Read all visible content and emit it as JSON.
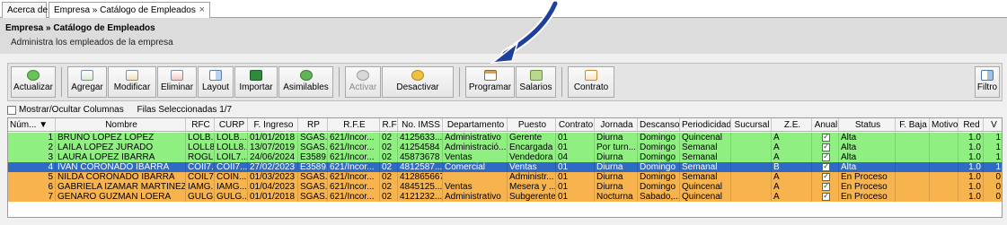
{
  "tabs": [
    {
      "label": "Acerca de"
    },
    {
      "label": "Empresa » Catálogo de Empleados",
      "close": "×"
    }
  ],
  "header": {
    "breadcrumb": "Empresa » Catálogo de Empleados",
    "subtitle": "Administra los empleados de la empresa"
  },
  "toolbar": {
    "actualizar": "Actualizar",
    "agregar": "Agregar",
    "modificar": "Modificar",
    "eliminar": "Eliminar",
    "layout": "Layout",
    "importar": "Importar",
    "asimilables": "Asimilables",
    "activar": "Activar",
    "desactivar": "Desactivar",
    "programar": "Programar",
    "salarios": "Salarios",
    "contrato": "Contrato",
    "filtro": "Filtro"
  },
  "options": {
    "show_hide_columns": "Mostrar/Ocultar Columnas",
    "selected_rows": "Filas Seleccionadas 1/7"
  },
  "columns": {
    "num": "Núm...",
    "nombre": "Nombre",
    "rfc": "RFC",
    "curp": "CURP",
    "ingreso": "F. Ingreso",
    "rp": "RP",
    "rfe": "R.F.E",
    "rf": "R.F",
    "imss": "No. IMSS",
    "depto": "Departamento",
    "puesto": "Puesto",
    "contrato": "Contrato",
    "jornada": "Jornada",
    "descanso": "Descanso",
    "periodicidad": "Periodicidad",
    "sucursal": "Sucursal",
    "ze": "Z.E.",
    "anual": "Anual",
    "status": "Status",
    "baja": "F. Baja",
    "motivo": "Motivo",
    "red": "Red",
    "v": "V"
  },
  "rows": [
    {
      "num": "1",
      "nombre": "BRUNO LOPEZ LOPEZ",
      "rfc": "LOLB...",
      "curp": "LOLB...",
      "ingreso": "01/01/2018",
      "rp": "SGAS...",
      "rfe": "621/Incor...",
      "rf": "02",
      "imss": "4125633...",
      "depto": "Administrativo",
      "puesto": "Gerente",
      "contrato": "01",
      "jornada": "Diurna",
      "descanso": "Domingo",
      "periodicidad": "Quincenal",
      "sucursal": "",
      "ze": "A",
      "status": "Alta",
      "baja": "",
      "motivo": "",
      "red": "1.0",
      "v": "1",
      "color": "green"
    },
    {
      "num": "2",
      "nombre": "LAILA LOPEZ JURADO",
      "rfc": "LOLL8...",
      "curp": "LOLL8...",
      "ingreso": "13/07/2019",
      "rp": "SGAS...",
      "rfe": "621/Incor...",
      "rf": "02",
      "imss": "41254584",
      "depto": "Administració...",
      "puesto": "Encargada",
      "contrato": "01",
      "jornada": "Por turn...",
      "descanso": "Domingo",
      "periodicidad": "Semanal",
      "sucursal": "",
      "ze": "A",
      "status": "Alta",
      "baja": "",
      "motivo": "",
      "red": "1.0",
      "v": "1",
      "color": "green"
    },
    {
      "num": "3",
      "nombre": "LAURA LOPEZ IBARRA",
      "rfc": "ROGL...",
      "curp": "LOIL7...",
      "ingreso": "24/06/2024",
      "rp": "E3589...",
      "rfe": "621/Incor...",
      "rf": "02",
      "imss": "45873678",
      "depto": "Ventas",
      "puesto": "Vendedora",
      "contrato": "04",
      "jornada": "Diurna",
      "descanso": "Domingo",
      "periodicidad": "Semanal",
      "sucursal": "",
      "ze": "A",
      "status": "Alta",
      "baja": "",
      "motivo": "",
      "red": "1.0",
      "v": "1",
      "color": "green"
    },
    {
      "num": "4",
      "nombre": "IVAN CORONADO IBARRA",
      "rfc": "COII7...",
      "curp": "COII7...",
      "ingreso": "27/02/2023",
      "rp": "E3589...",
      "rfe": "621/Incor...",
      "rf": "02",
      "imss": "4812587...",
      "depto": "Comercial",
      "puesto": "Ventas",
      "contrato": "01",
      "jornada": "Diurna",
      "descanso": "Domingo",
      "periodicidad": "Semanal",
      "sucursal": "",
      "ze": "B",
      "status": "Alta",
      "baja": "",
      "motivo": "",
      "red": "1.0",
      "v": "1",
      "color": "sel"
    },
    {
      "num": "5",
      "nombre": "NILDA CORONADO IBARRA",
      "rfc": "COIL7...",
      "curp": "COIN...",
      "ingreso": "01/03/2023",
      "rp": "SGAS...",
      "rfe": "621/Incor...",
      "rf": "02",
      "imss": "412865667",
      "depto": "",
      "puesto": "Administr...",
      "contrato": "01",
      "jornada": "Diurna",
      "descanso": "Domingo",
      "periodicidad": "Semanal",
      "sucursal": "",
      "ze": "A",
      "status": "En Proceso",
      "baja": "",
      "motivo": "",
      "red": "1.0",
      "v": "0",
      "color": "orange"
    },
    {
      "num": "6",
      "nombre": "GABRIELA IZAMAR MARTINEZ",
      "rfc": "IAMG...",
      "curp": "IAMG...",
      "ingreso": "01/04/2023",
      "rp": "SGAS...",
      "rfe": "621/Incor...",
      "rf": "02",
      "imss": "4845125...",
      "depto": "Ventas",
      "puesto": "Mesera y ...",
      "contrato": "01",
      "jornada": "Diurna",
      "descanso": "Domingo",
      "periodicidad": "Quincenal",
      "sucursal": "",
      "ze": "A",
      "status": "En Proceso",
      "baja": "",
      "motivo": "",
      "red": "1.0",
      "v": "0",
      "color": "orange"
    },
    {
      "num": "7",
      "nombre": "GENARO GUZMAN LOERA",
      "rfc": "GULG...",
      "curp": "GULG...",
      "ingreso": "01/01/2018",
      "rp": "SGAS...",
      "rfe": "621/Incor...",
      "rf": "02",
      "imss": "4121232...",
      "depto": "Administrativo",
      "puesto": "Subgerente",
      "contrato": "01",
      "jornada": "Nocturna",
      "descanso": "Sabado,...",
      "periodicidad": "Quincenal",
      "sucursal": "",
      "ze": "A",
      "status": "En Proceso",
      "baja": "",
      "motivo": "",
      "red": "1.0",
      "v": "0",
      "color": "orange"
    }
  ],
  "colors": {
    "alta": "#8fef80",
    "en_proceso": "#f6b34e",
    "selected": "#2f6bc4",
    "arrow": "#1f3f9e"
  }
}
